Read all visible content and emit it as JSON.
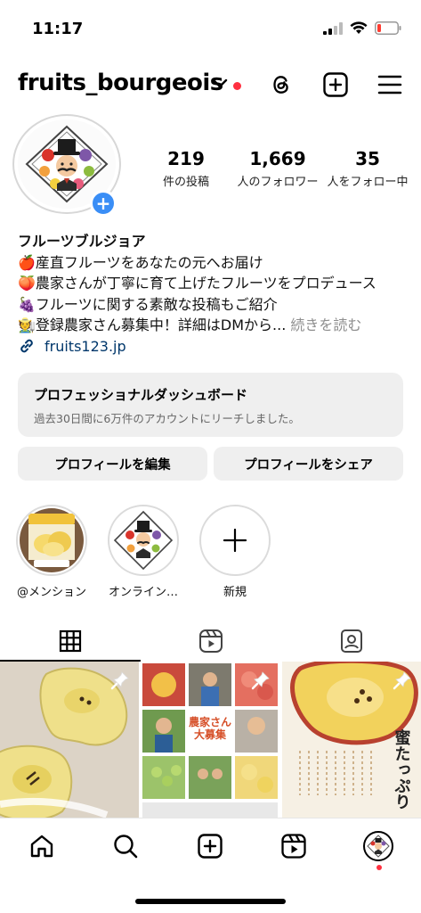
{
  "status": {
    "time": "11:17"
  },
  "header": {
    "username": "fruits_bourgeois"
  },
  "profile": {
    "stats": [
      {
        "num": "219",
        "label": "件の投稿"
      },
      {
        "num": "1,669",
        "label": "人のフォロワー"
      },
      {
        "num": "35",
        "label": "人をフォロー中"
      }
    ],
    "name": "フルーツブルジョア",
    "bio_lines": [
      "🍎産直フルーツをあなたの元へお届け",
      "🍑農家さんが丁寧に育て上げたフルーツをプロデュース",
      "🍇フルーツに関する素敵な投稿もご紹介",
      "🧑‍🌾登録農家さん募集中！詳細はDMから..."
    ],
    "more_label": "続きを読む",
    "link": "fruits123.jp"
  },
  "dashboard": {
    "title": "プロフェッショナルダッシュボード",
    "subtitle": "過去30日間に6万件のアカウントにリーチしました。"
  },
  "buttons": {
    "edit": "プロフィールを編集",
    "share": "プロフィールをシェア"
  },
  "highlights": [
    {
      "label": "@メンション"
    },
    {
      "label": "オンライン…"
    },
    {
      "label": "新規"
    }
  ],
  "posts": {
    "post2_caption": "農家さん\n大募集",
    "post3_caption": "蜜たっぷり"
  },
  "colors": {
    "accent": "#3a8ef6",
    "notification": "#ff3040",
    "link": "#00376b"
  }
}
